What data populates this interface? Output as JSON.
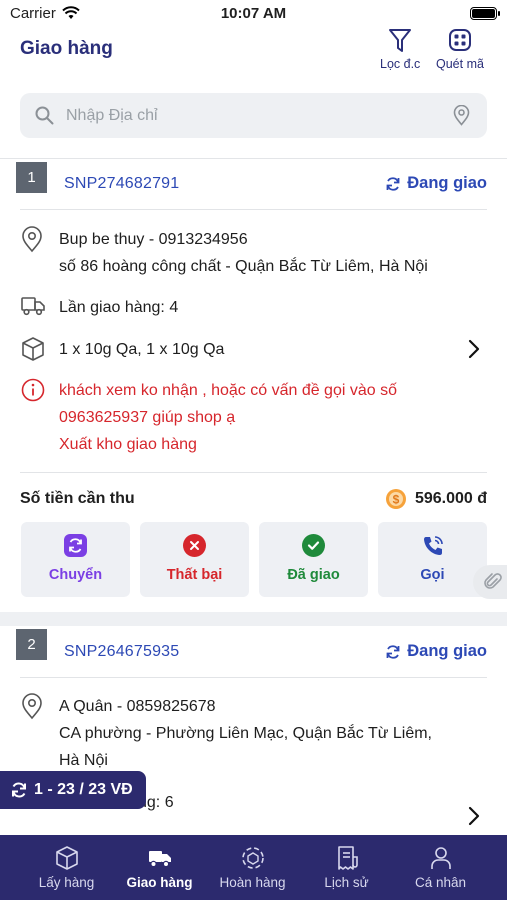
{
  "status_bar": {
    "carrier": "Carrier",
    "time": "10:07 AM"
  },
  "header": {
    "title": "Giao hàng",
    "filter_label": "Lọc đ.c",
    "scan_label": "Quét mã"
  },
  "search": {
    "placeholder": "Nhập Địa chỉ"
  },
  "orders": [
    {
      "index": "1",
      "code": "SNP274682791",
      "status": "Đang giao",
      "customer": "Bup be thuy - 0913234956",
      "address": "số 86 hoàng công chất - Quận Bắc Từ Liêm, Hà Nội",
      "attempts": "Lần giao hàng: 4",
      "items": "1 x 10g Qa, 1 x 10g Qa",
      "note_lines": [
        "khách xem ko nhận , hoặc có vấn đề gọi vào số",
        "0963625937 giúp shop ạ",
        "Xuất kho giao hàng"
      ],
      "amount_label": "Số tiền cần thu",
      "amount": "596.000 đ",
      "actions": [
        {
          "label": "Chuyển",
          "color": "#7b3fe4"
        },
        {
          "label": "Thất bại",
          "color": "#d6262c"
        },
        {
          "label": "Đã giao",
          "color": "#1f8a3b"
        },
        {
          "label": "Gọi",
          "color": "#2d49b5"
        }
      ]
    },
    {
      "index": "2",
      "code": "SNP264675935",
      "status": "Đang giao",
      "customer": "A Quân - 0859825678",
      "address_lines": [
        "CA phường - Phường Liên Mạc, Quận Bắc Từ Liêm,",
        "Hà Nội"
      ],
      "attempts_partial": "ng: 6"
    }
  ],
  "pager": {
    "text": "1 - 23 / 23 VĐ"
  },
  "tabbar": {
    "tabs": [
      {
        "label": "Lấy hàng",
        "icon": "box-icon"
      },
      {
        "label": "Giao hàng",
        "icon": "delivery-truck-icon",
        "active": true
      },
      {
        "label": "Hoàn hàng",
        "icon": "return-icon"
      },
      {
        "label": "Lịch sử",
        "icon": "history-icon"
      },
      {
        "label": "Cá nhân",
        "icon": "person-icon"
      }
    ]
  },
  "colors": {
    "primary": "#2c2a6e",
    "link": "#2d49b5",
    "danger": "#d6262c",
    "success": "#1f8a3b"
  }
}
